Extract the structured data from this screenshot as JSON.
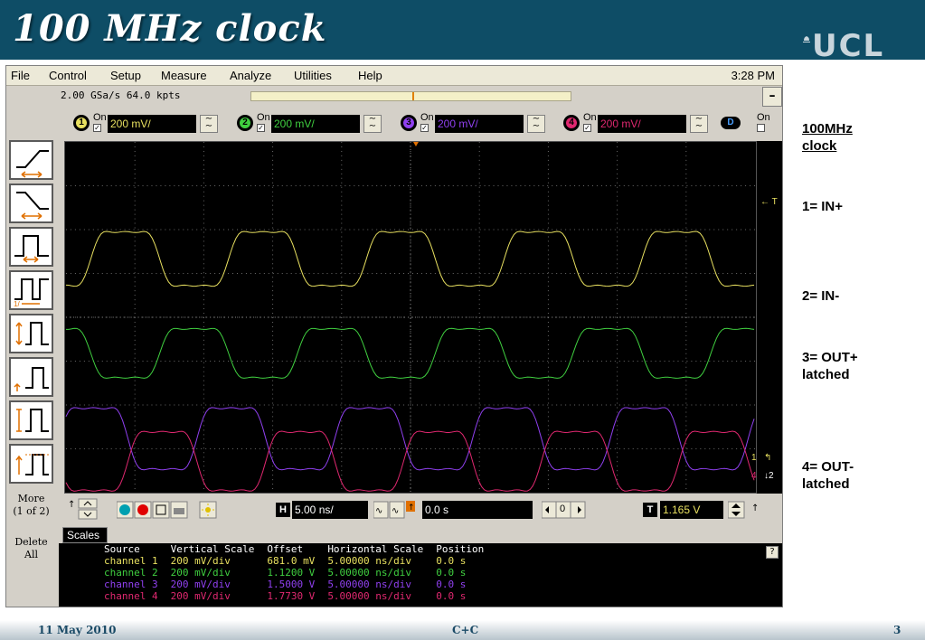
{
  "slide": {
    "title": "100 MHz clock",
    "logo": "UCL",
    "footer_date": "11 May 2010",
    "footer_center": "C+C",
    "page_number": "3"
  },
  "notes": {
    "title": "100MHz clock",
    "items": [
      "1= IN+",
      "2= IN-",
      "3= OUT+ latched",
      "4= OUT- latched"
    ]
  },
  "scope": {
    "menu": [
      "File",
      "Control",
      "Setup",
      "Measure",
      "Analyze",
      "Utilities",
      "Help"
    ],
    "time": "3:28 PM",
    "acquisition": "2.00 GSa/s   64.0 kpts",
    "minimize_label": "–",
    "channels": [
      {
        "num": "1",
        "on_label": "On",
        "scale": "200 mV/",
        "color": "#e8e060"
      },
      {
        "num": "2",
        "on_label": "On",
        "scale": "200 mV/",
        "color": "#40d040"
      },
      {
        "num": "3",
        "on_label": "On",
        "scale": "200 mV/",
        "color": "#9040f0"
      },
      {
        "num": "4",
        "on_label": "On",
        "scale": "200 mV/",
        "color": "#e02870"
      }
    ],
    "digital": {
      "label": "D",
      "on_label": "On"
    },
    "softkeys": {
      "more": "More",
      "more_page": "(1 of 2)",
      "delete": "Delete",
      "delete2": "All"
    },
    "markers": {
      "trigger": "T",
      "ch1": "1",
      "ch4": "4",
      "ch2": "2"
    },
    "controls": {
      "time_letter": "H",
      "time_scale": "5.00 ns/",
      "time_position": "0.0 s",
      "position_value": "0",
      "trigger_letter": "T",
      "trigger_level": "1.165 V"
    },
    "scales": {
      "tab": "Scales",
      "headers": [
        "Source",
        "Vertical Scale",
        "Offset",
        "Horizontal Scale",
        "Position"
      ],
      "rows": [
        [
          "channel 1",
          "200 mV/div",
          "681.0 mV",
          "5.00000 ns/div",
          "0.0 s"
        ],
        [
          "channel 2",
          "200 mV/div",
          "1.1200 V",
          "5.00000 ns/div",
          "0.0 s"
        ],
        [
          "channel 3",
          "200 mV/div",
          "1.5000 V",
          "5.00000 ns/div",
          "0.0 s"
        ],
        [
          "channel 4",
          "200 mV/div",
          "1.7730 V",
          "5.00000 ns/div",
          "0.0 s"
        ]
      ],
      "help": "?"
    }
  }
}
